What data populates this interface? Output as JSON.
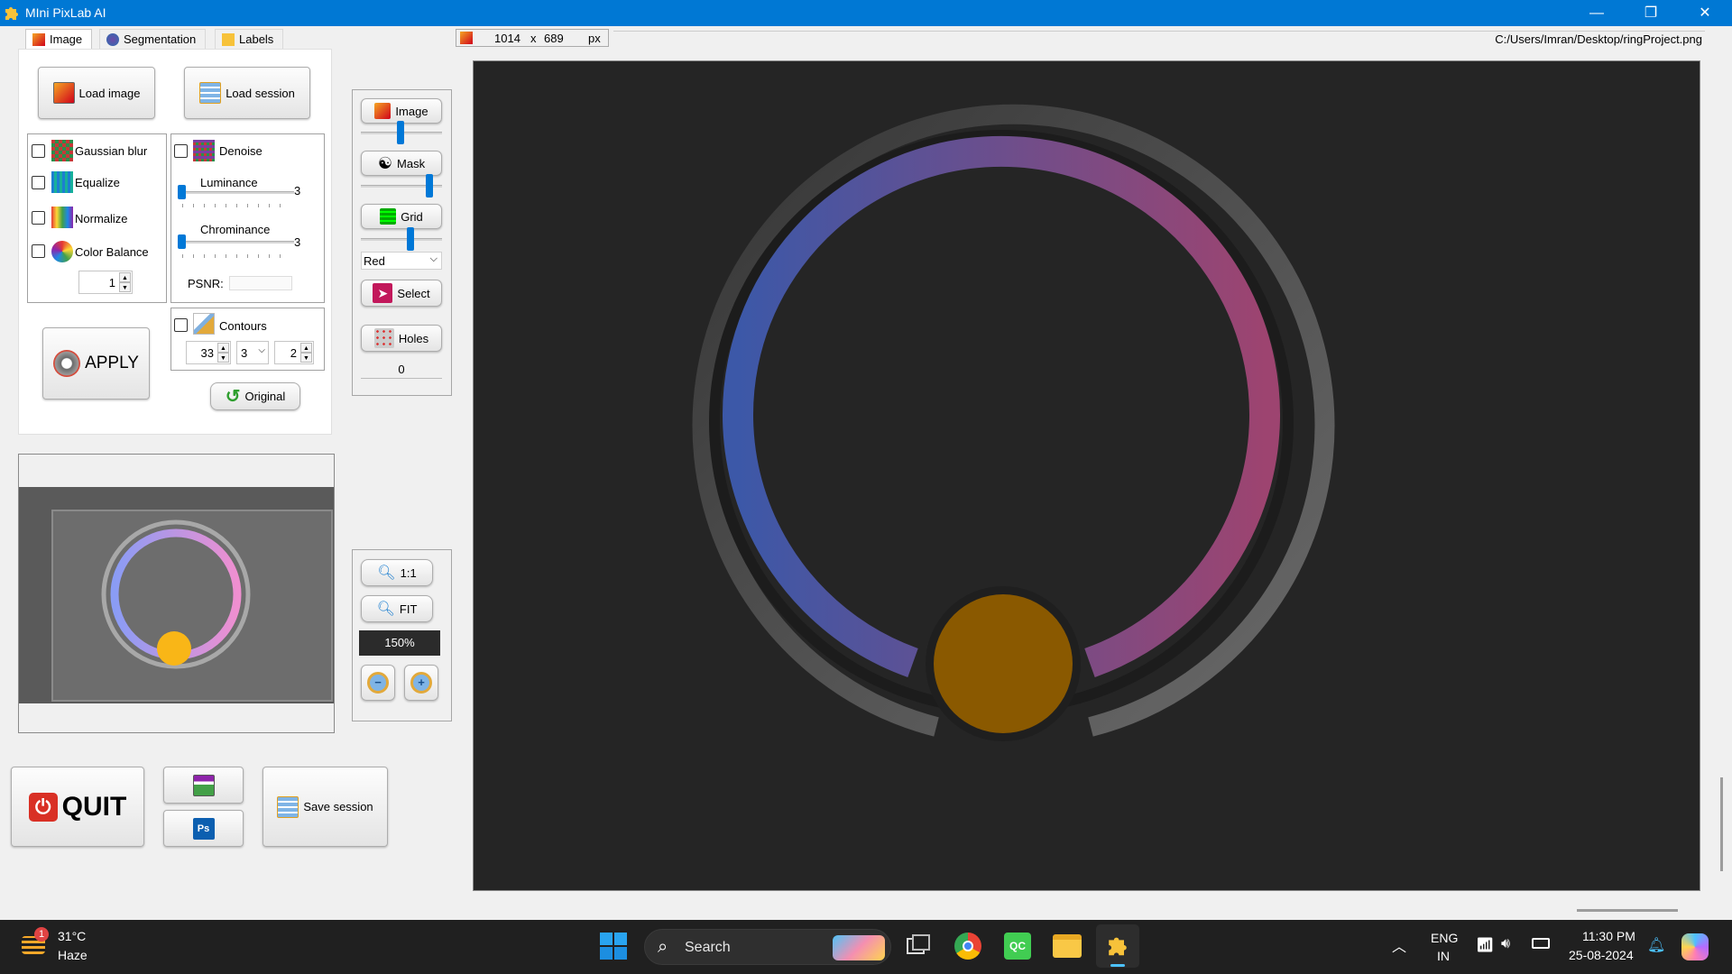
{
  "window": {
    "title": "MIni PixLab AI",
    "minimize": "—",
    "restore": "❐",
    "close": "✕"
  },
  "tabs": [
    {
      "label": "Image",
      "active": true
    },
    {
      "label": "Segmentation",
      "active": false
    },
    {
      "label": "Labels",
      "active": false
    }
  ],
  "status": {
    "width": "1014",
    "x": "x",
    "height": "689",
    "unit": "px",
    "path": "C:/Users/Imran/Desktop/ringProject.png"
  },
  "left": {
    "load_image": "Load image",
    "load_session": "Load session",
    "filters": {
      "gaussian": "Gaussian blur",
      "equalize": "Equalize",
      "normalize": "Normalize",
      "color_balance": "Color Balance",
      "color_balance_value": "1"
    },
    "denoise": {
      "label": "Denoise",
      "luminance_label": "Luminance",
      "luminance_value": "3",
      "chrominance_label": "Chrominance",
      "chrominance_value": "3",
      "psnr_label": "PSNR:"
    },
    "apply": "APPLY",
    "contours": {
      "label": "Contours",
      "val1": "33",
      "val2": "3",
      "val3": "2"
    },
    "original": "Original",
    "quit": "QUIT",
    "save_session": "Save session"
  },
  "tools": {
    "image": "Image",
    "mask": "Mask",
    "grid": "Grid",
    "color_select": "Red",
    "select": "Select",
    "holes": "Holes",
    "holes_count": "0",
    "zoom_1_1": "1:1",
    "fit": "FIT",
    "zoom_level": "150%"
  },
  "taskbar": {
    "weather_temp": "31°C",
    "weather_cond": "Haze",
    "weather_badge": "1",
    "search": "Search",
    "lang1": "ENG",
    "lang2": "IN",
    "time": "11:30 PM",
    "date": "25-08-2024"
  },
  "colors": {
    "titlebar": "#0078d4",
    "canvas_bg": "#252525",
    "ring_left": "#3f54a0",
    "ring_right": "#a0456e",
    "ball": "#8a5a00",
    "accent": "#0078d7"
  }
}
